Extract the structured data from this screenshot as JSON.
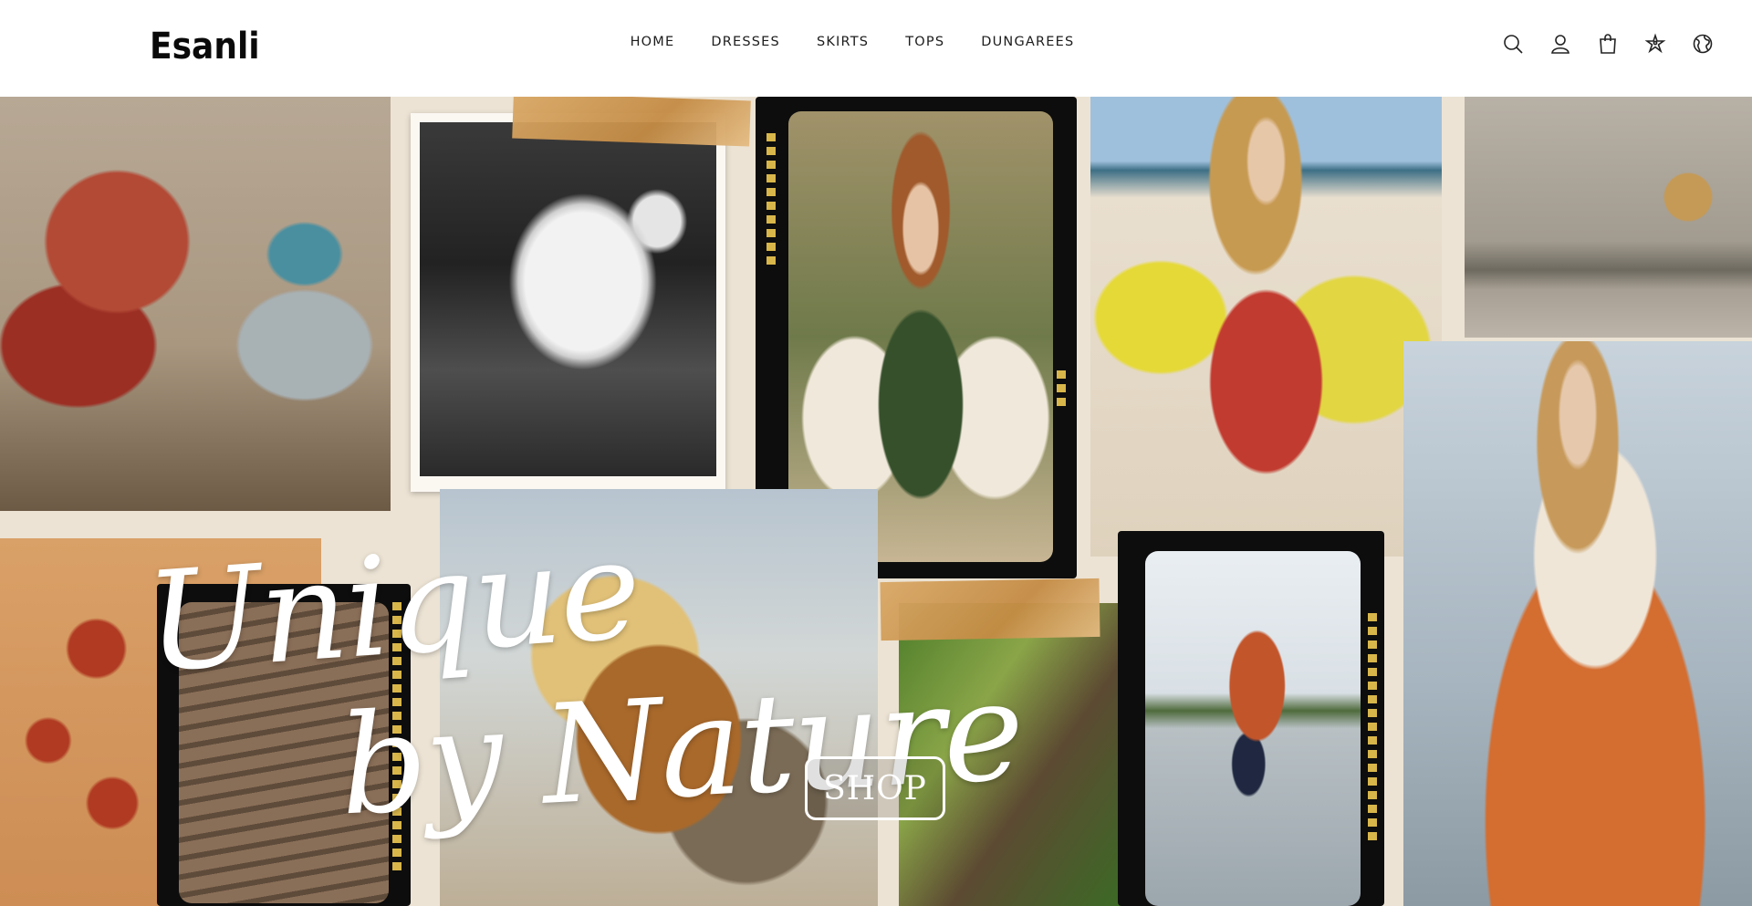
{
  "brand": {
    "logo_text": "Esanli"
  },
  "nav": {
    "items": [
      {
        "label": "HOME"
      },
      {
        "label": "DRESSES"
      },
      {
        "label": "SKIRTS"
      },
      {
        "label": "TOPS"
      },
      {
        "label": "DUNGAREES"
      }
    ]
  },
  "header_icons": [
    "search-icon",
    "account-icon",
    "bag-icon",
    "star-sticker-icon",
    "globe-icon"
  ],
  "hero": {
    "title_line1": "Unique",
    "title_line2": "by Nature",
    "cta_label": "SHOP"
  },
  "colors": {
    "header_bg": "#ffffff",
    "nav_text": "#1c1c1c",
    "hero_text": "#ffffff",
    "film_frame": "#0d0d0d",
    "film_sprocket": "#d8b64a",
    "tape": "#c48b44"
  }
}
